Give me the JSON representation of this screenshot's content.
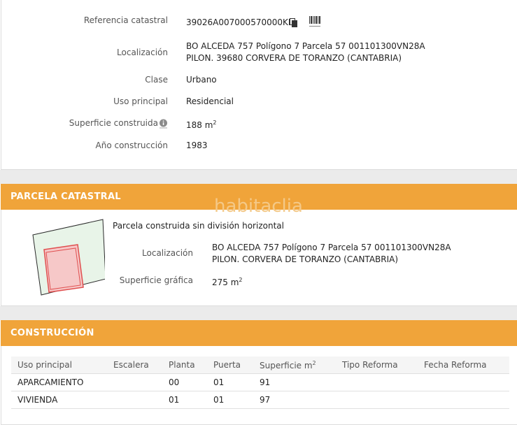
{
  "ficha": {
    "referencia_label": "Referencia catastral",
    "referencia_value": "39026A007000570000KM",
    "localizacion_label": "Localización",
    "localizacion_line1": "BO ALCEDA 757 Polígono 7 Parcela 57 001101300VN28A",
    "localizacion_line2": "PILON. 39680 CORVERA DE TORANZO (CANTABRIA)",
    "clase_label": "Clase",
    "clase_value": "Urbano",
    "uso_label": "Uso principal",
    "uso_value": "Residencial",
    "superficie_label": "Superficie construida",
    "superficie_value": "188 m",
    "superficie_exp": "2",
    "anio_label": "Año construcción",
    "anio_value": "1983"
  },
  "parcela": {
    "title": "PARCELA CATASTRAL",
    "watermark": "habitaclia",
    "description": "Parcela construida sin división horizontal",
    "localizacion_label": "Localización",
    "localizacion_line1": "BO ALCEDA 757 Polígono 7 Parcela 57 001101300VN28A",
    "localizacion_line2": "PILON. CORVERA DE TORANZO (CANTABRIA)",
    "superficie_label": "Superficie gráfica",
    "superficie_value": "275 m",
    "superficie_exp": "2"
  },
  "construccion": {
    "title": "CONSTRUCCIÓN",
    "columns": [
      "Uso principal",
      "Escalera",
      "Planta",
      "Puerta",
      "Superficie m",
      "Tipo Reforma",
      "Fecha Reforma"
    ],
    "superficie_exp": "2",
    "rows": [
      [
        "APARCAMIENTO",
        "",
        "00",
        "01",
        "91",
        "",
        ""
      ],
      [
        "VIVIENDA",
        "",
        "01",
        "01",
        "97",
        "",
        ""
      ]
    ]
  },
  "colors": {
    "header_orange": "#f0a43a",
    "parcel_fill": "#e8f4e8",
    "building_stroke": "#e05050"
  },
  "icons": [
    "copy-icon",
    "barcode-icon",
    "info-icon"
  ]
}
